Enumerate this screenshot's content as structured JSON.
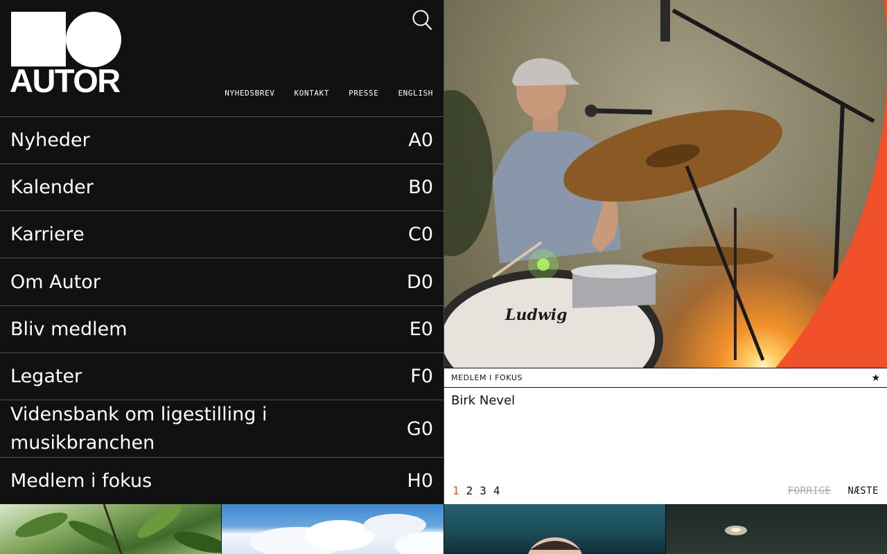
{
  "logo": {
    "wordmark": "AUTOR"
  },
  "top_nav": [
    "NYHEDSBREV",
    "KONTAKT",
    "PRESSE",
    "ENGLISH"
  ],
  "menu": [
    {
      "label": "Nyheder",
      "code": "A0"
    },
    {
      "label": "Kalender",
      "code": "B0"
    },
    {
      "label": "Karriere",
      "code": "C0"
    },
    {
      "label": "Om Autor",
      "code": "D0"
    },
    {
      "label": "Bliv medlem",
      "code": "E0"
    },
    {
      "label": "Legater",
      "code": "F0"
    },
    {
      "label": "Vidensbank om ligestilling i musikbranchen",
      "code": "G0"
    },
    {
      "label": "Medlem i fokus",
      "code": "H0"
    }
  ],
  "focus": {
    "kicker": "MEDLEM I FOKUS",
    "star": "★",
    "name": "Birk Nevel",
    "pages": [
      "1",
      "2",
      "3",
      "4"
    ],
    "active_page": "1",
    "prev_label": "FORRIGE",
    "next_label": "NÆSTE"
  },
  "drum_brand": "Ludwig",
  "colors": {
    "accent": "#f0502a",
    "background": "#111111"
  }
}
